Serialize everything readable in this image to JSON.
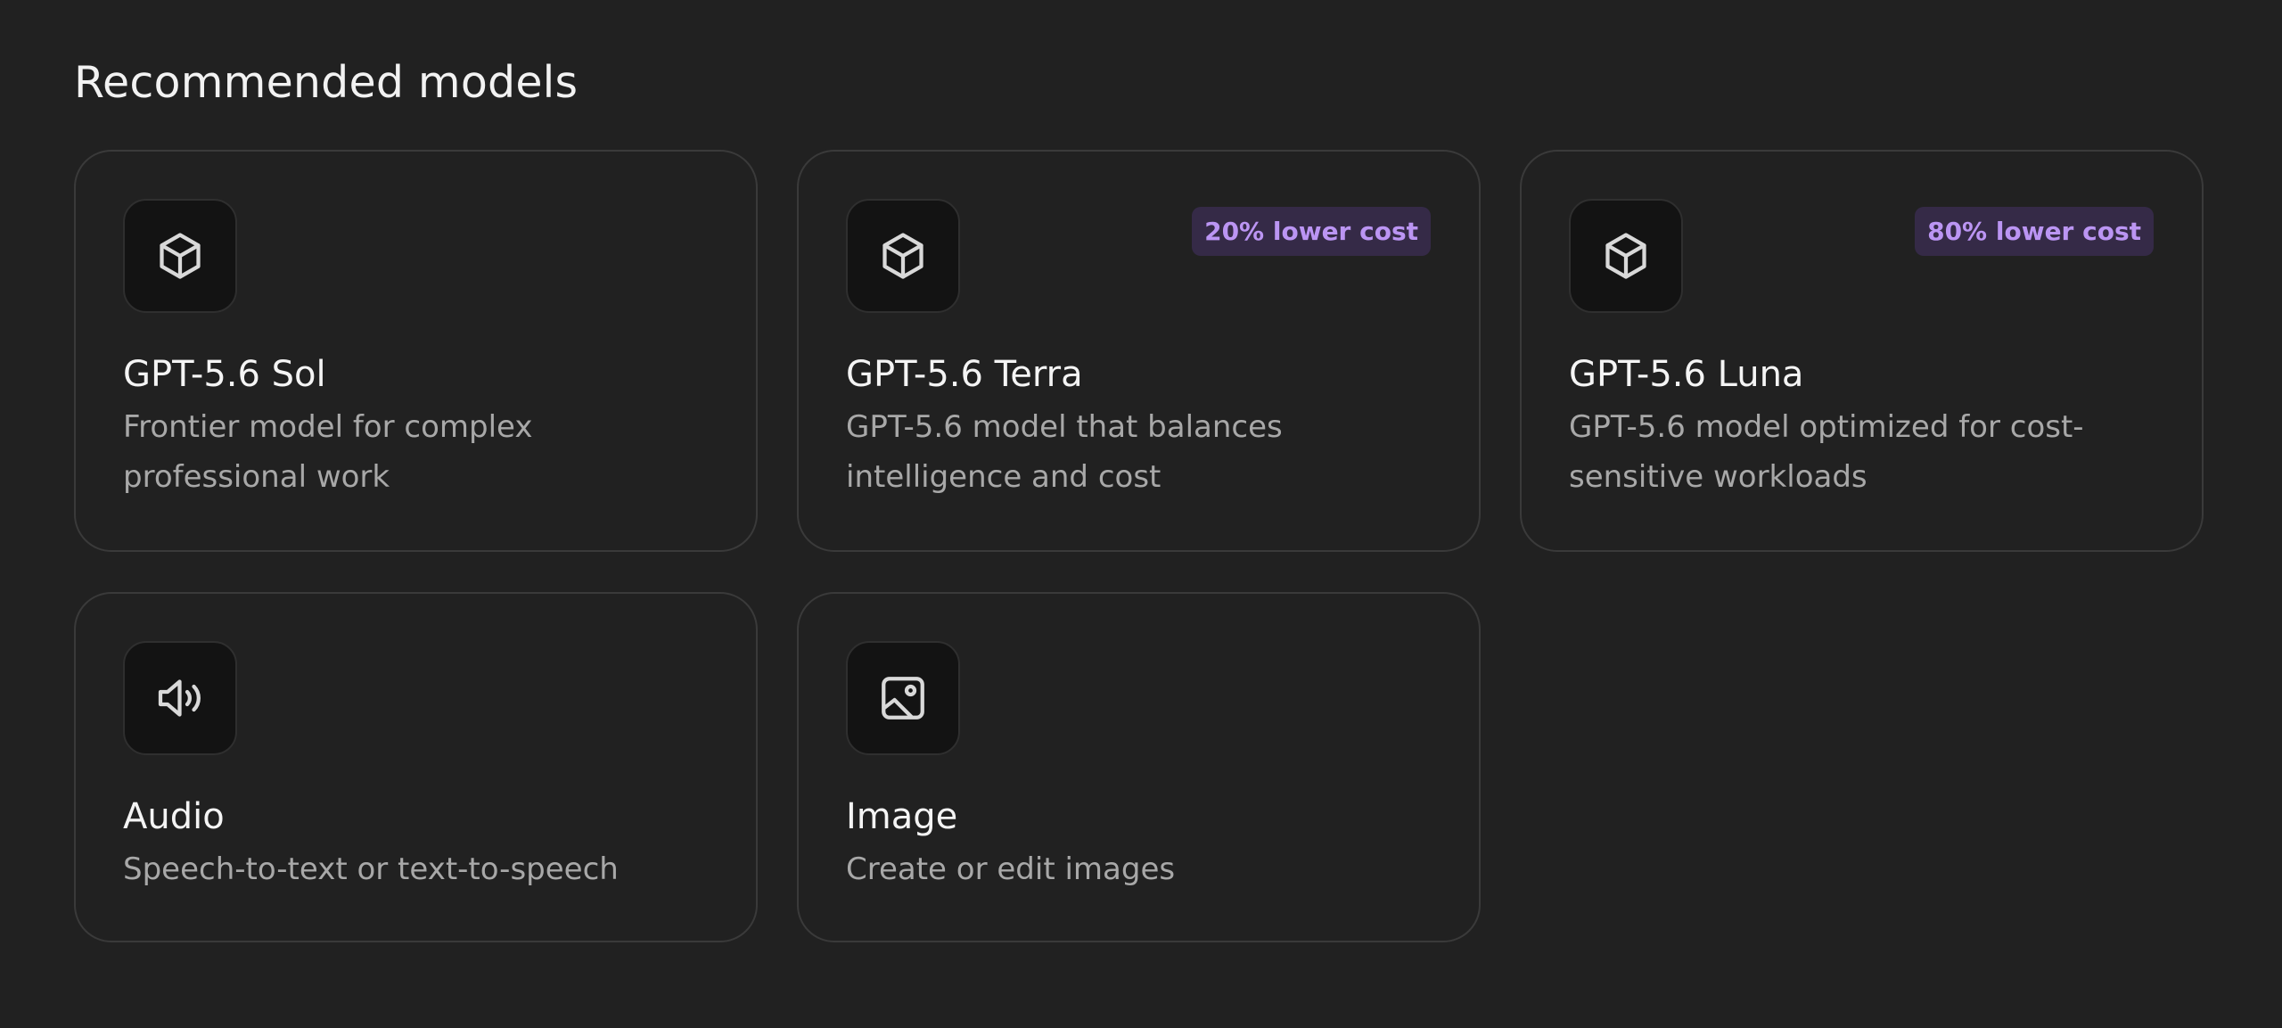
{
  "section": {
    "title": "Recommended models"
  },
  "cards": [
    {
      "icon": "cube-icon",
      "title": "GPT-5.6 Sol",
      "description": "Frontier model for complex professional work",
      "badge": ""
    },
    {
      "icon": "cube-icon",
      "title": "GPT-5.6 Terra",
      "description": "GPT-5.6 model that balances intelligence and cost",
      "badge": "20% lower cost"
    },
    {
      "icon": "cube-icon",
      "title": "GPT-5.6 Luna",
      "description": "GPT-5.6 model optimized for cost-sensitive workloads",
      "badge": "80% lower cost"
    },
    {
      "icon": "speaker-icon",
      "title": "Audio",
      "description": "Speech-to-text or text-to-speech",
      "badge": ""
    },
    {
      "icon": "image-icon",
      "title": "Image",
      "description": "Create or edit images",
      "badge": ""
    }
  ],
  "colors": {
    "background": "#212121",
    "card_border": "#3a3a3a",
    "icon_tile": "#131313",
    "badge_background": "#352a47",
    "badge_text": "#bb95f3",
    "title_text": "#f4f4f4",
    "description_text": "#a8a8a8"
  }
}
